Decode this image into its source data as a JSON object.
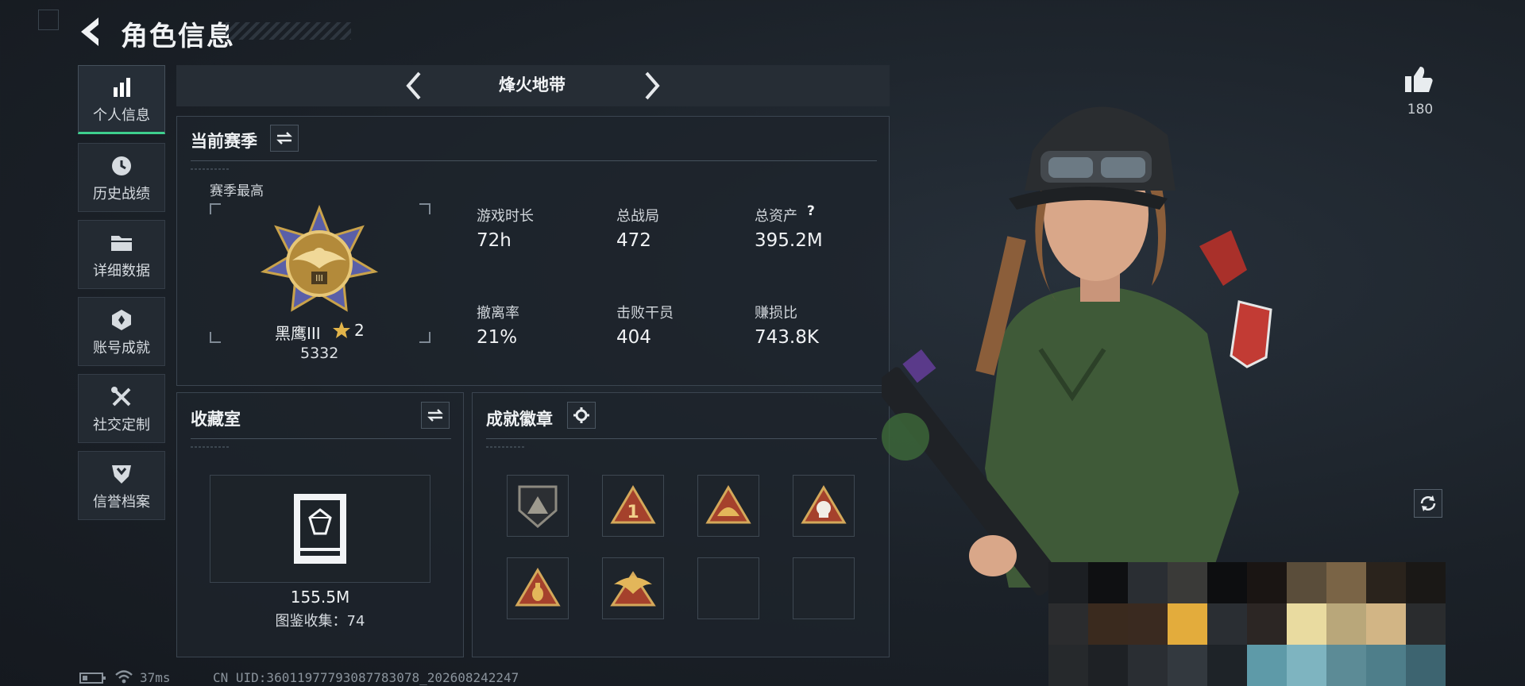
{
  "header": {
    "title": "角色信息"
  },
  "sidebar": {
    "items": [
      {
        "label": "个人信息",
        "icon": "bar-chart-icon",
        "active": true
      },
      {
        "label": "历史战绩",
        "icon": "clock-icon"
      },
      {
        "label": "详细数据",
        "icon": "folder-icon"
      },
      {
        "label": "账号成就",
        "icon": "medal-icon"
      },
      {
        "label": "社交定制",
        "icon": "tools-icon"
      },
      {
        "label": "信誉档案",
        "icon": "shield-icon"
      }
    ]
  },
  "mode": {
    "title": "烽火地带"
  },
  "season": {
    "heading": "当前赛季",
    "best_label": "赛季最高",
    "rank_name": "黑鹰III",
    "rank_stars": "2",
    "rank_score": "5332",
    "stats": [
      {
        "label": "游戏时长",
        "value": "72h"
      },
      {
        "label": "总战局",
        "value": "472"
      },
      {
        "label": "总资产",
        "value": "395.2M",
        "help": "?"
      },
      {
        "label": "撤离率",
        "value": "21%"
      },
      {
        "label": "击败干员",
        "value": "404"
      },
      {
        "label": "赚损比",
        "value": "743.8K"
      }
    ]
  },
  "collection": {
    "heading": "收藏室",
    "value": "155.5M",
    "count_text": "图鉴收集：74"
  },
  "achievements": {
    "heading": "成就徽章",
    "badges": [
      "achievement-badge-mountain",
      "achievement-badge-number-one",
      "achievement-badge-helmet",
      "achievement-badge-skull",
      "achievement-badge-grenade",
      "achievement-badge-eagle",
      "",
      ""
    ]
  },
  "right": {
    "like_count": "180"
  },
  "footer": {
    "ping": "37ms",
    "uid": "CN UID:3601197779308778307​8_202608242247"
  },
  "colors": {
    "accent_green": "#3ecf8e",
    "gold": "#c9a24a",
    "badge_red": "#b8482e"
  }
}
